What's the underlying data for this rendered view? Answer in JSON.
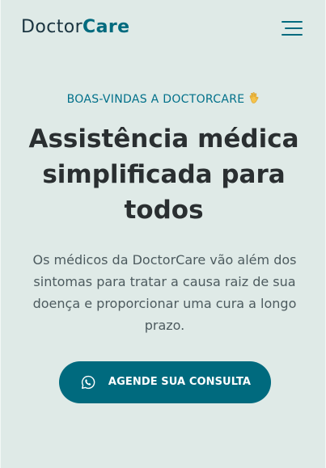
{
  "brand": {
    "name_part1": "Doctor",
    "name_part2": "Care",
    "primary_color": "#006a7e",
    "dark_color": "#1a3440"
  },
  "header": {
    "menu_icon": "hamburger-menu-icon"
  },
  "hero": {
    "eyebrow": "BOAS-VINDAS A DOCTORCARE",
    "eyebrow_icon": "waving-hand-icon",
    "title": "Assistência médica simplificada para todos",
    "description": "Os médicos da DoctorCare vão além dos sintomas para tratar a causa raiz de sua doença e proporcionar uma cura a longo prazo.",
    "cta": {
      "label": "AGENDE SUA CONSULTA",
      "icon": "whatsapp-icon"
    }
  },
  "colors": {
    "background": "#dfeae7",
    "title": "#2a2f31",
    "text": "#4d5b5f",
    "accent": "#00708a",
    "button": "#006a7e"
  }
}
